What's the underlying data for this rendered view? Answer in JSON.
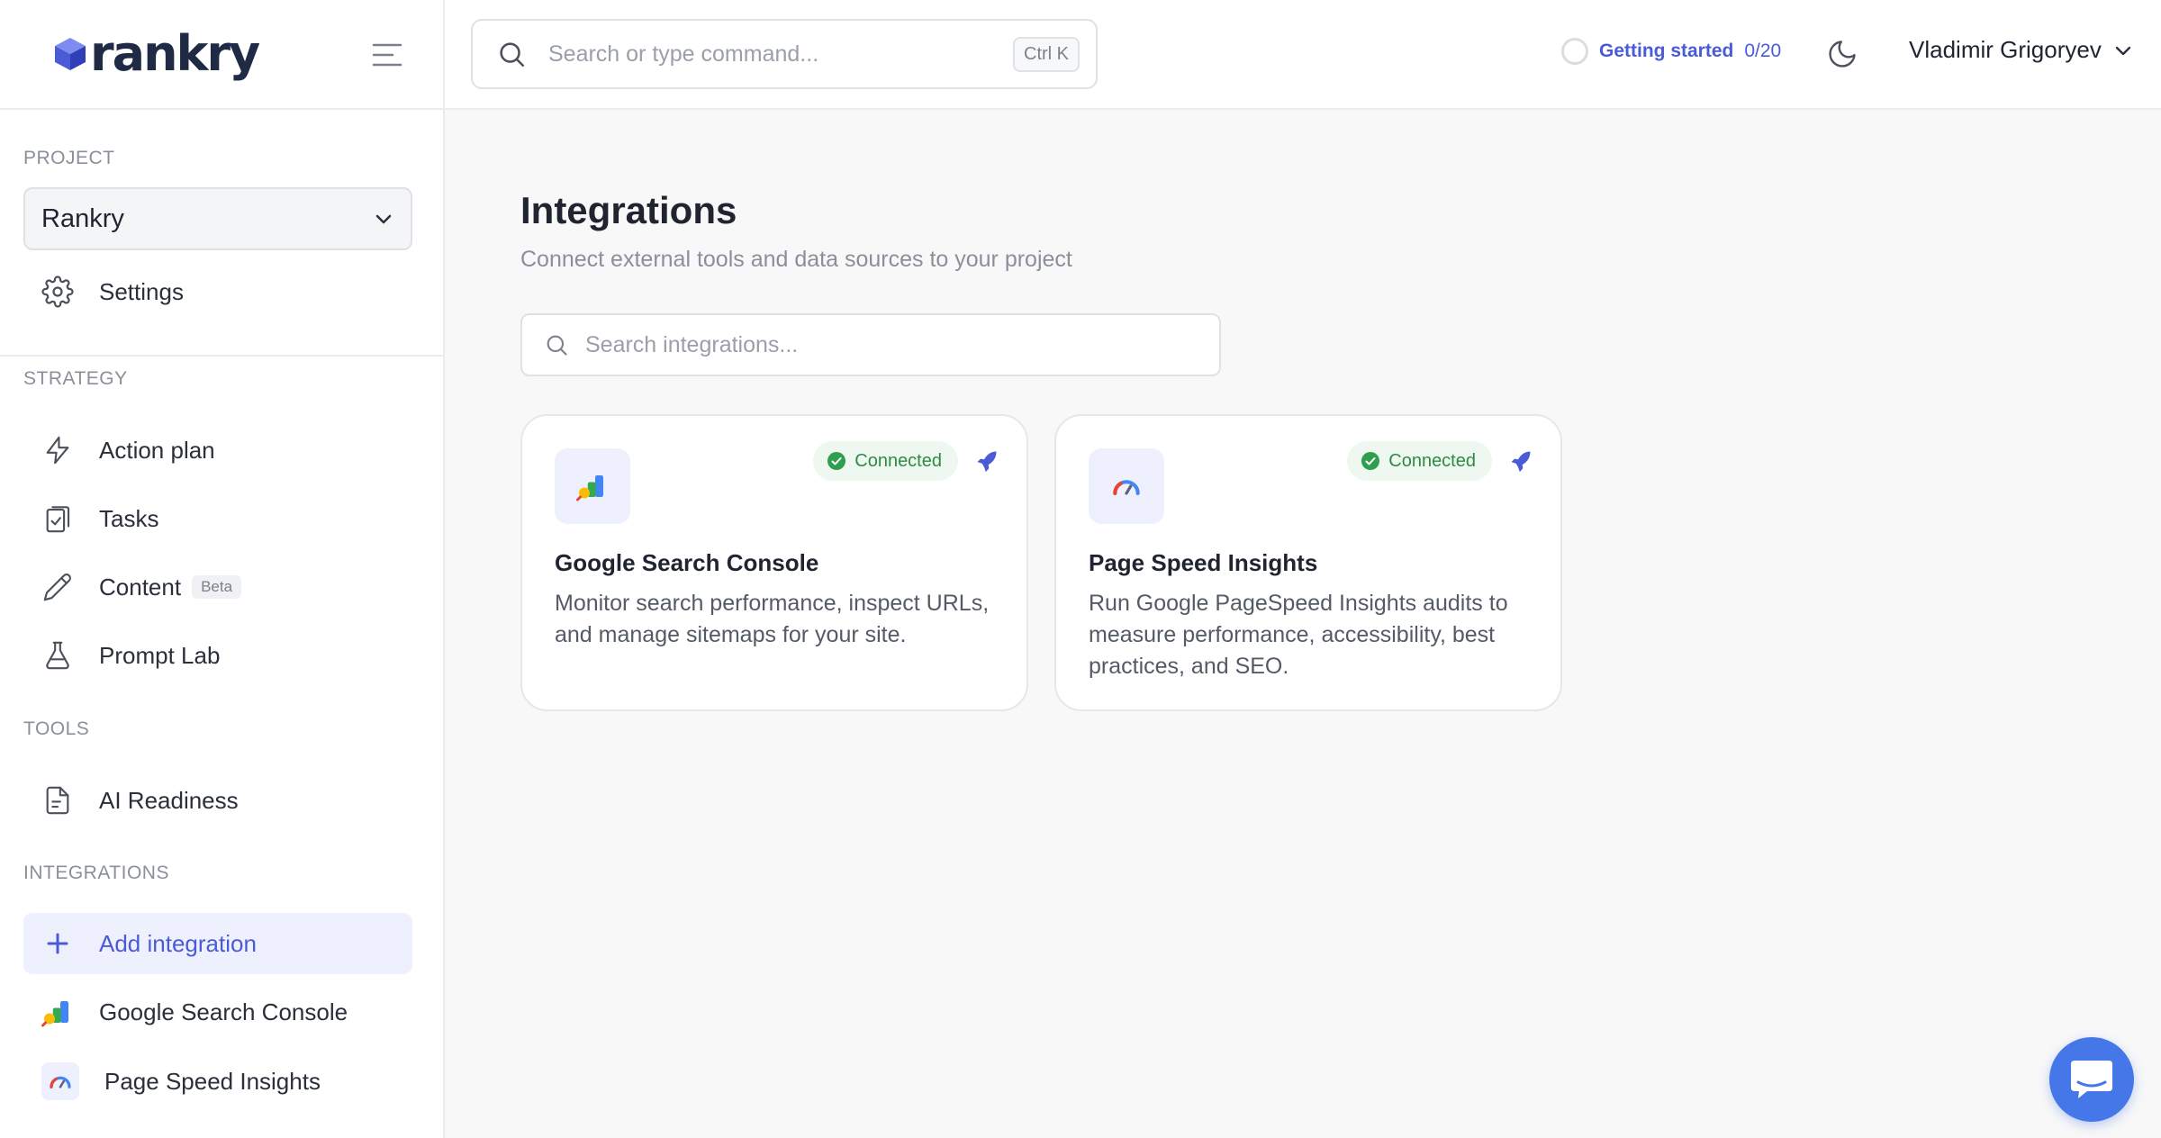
{
  "brand": {
    "name": "rankry"
  },
  "header": {
    "search_placeholder": "Search or type command...",
    "shortcut": "Ctrl K",
    "getting_started_label": "Getting started",
    "getting_started_count": "0/20",
    "user_name": "Vladimir Grigoryev"
  },
  "sidebar": {
    "project_label": "PROJECT",
    "project_value": "Rankry",
    "settings_label": "Settings",
    "strategy_label": "STRATEGY",
    "strategy_items": [
      {
        "label": "Action plan",
        "icon": "lightning-icon"
      },
      {
        "label": "Tasks",
        "icon": "clipboard-check-icon"
      },
      {
        "label": "Content",
        "icon": "pencil-icon",
        "badge": "Beta"
      },
      {
        "label": "Prompt Lab",
        "icon": "flask-icon"
      }
    ],
    "tools_label": "TOOLS",
    "tools_items": [
      {
        "label": "AI Readiness",
        "icon": "document-icon"
      }
    ],
    "integrations_label": "INTEGRATIONS",
    "integrations_items": [
      {
        "label": "Add integration",
        "icon": "plus-icon",
        "active": true
      },
      {
        "label": "Google Search Console",
        "icon": "search-console-icon"
      },
      {
        "label": "Page Speed Insights",
        "icon": "speedometer-icon"
      }
    ]
  },
  "main": {
    "title": "Integrations",
    "subtitle": "Connect external tools and data sources to your project",
    "search_placeholder": "Search integrations...",
    "cards": [
      {
        "title": "Google Search Console",
        "description": "Monitor search performance, inspect URLs, and manage sitemaps for your site.",
        "status": "Connected",
        "icon": "search-console-icon"
      },
      {
        "title": "Page Speed Insights",
        "description": "Run Google PageSpeed Insights audits to measure performance, accessibility, best practices, and SEO.",
        "status": "Connected",
        "icon": "speedometer-icon"
      }
    ]
  },
  "colors": {
    "accent": "#4a5bd8",
    "success": "#2f8a45",
    "chat_button": "#4677e8"
  }
}
